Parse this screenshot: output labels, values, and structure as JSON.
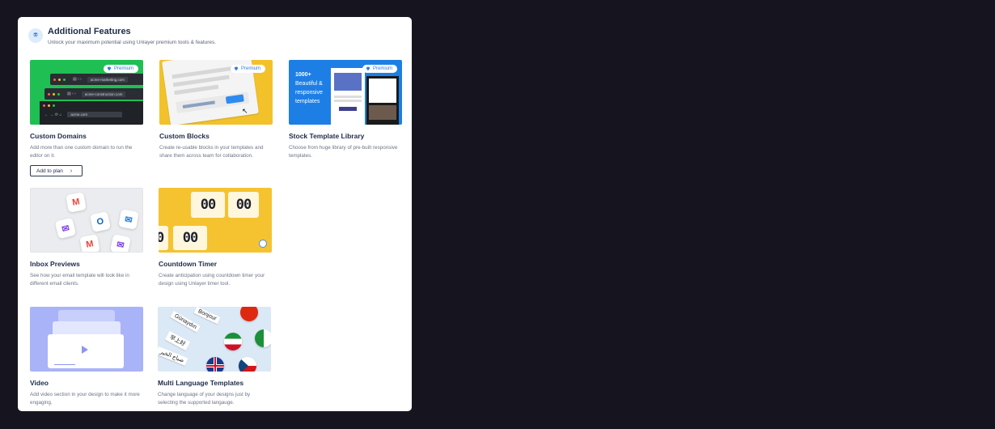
{
  "header": {
    "title": "Additional Features",
    "subtitle": "Unlock your maximum potential using Unlayer premium tools & features."
  },
  "badge_label": "Premium",
  "features": [
    {
      "title": "Custom Domains",
      "description": "Add more than one custom domain to run the editor on it.",
      "button_label": "Add to plan",
      "urls": [
        "acme-marketing.com",
        "acme-construction.com",
        "acme.com"
      ]
    },
    {
      "title": "Custom Blocks",
      "description": "Create re-usable blocks in your templates and share them across team for collaboration."
    },
    {
      "title": "Stock Template Library",
      "description": "Choose from huge library of pre-built responsive templates.",
      "thumb_heading": "1000+",
      "thumb_lines": [
        "Beautiful &",
        "responsive",
        "templates"
      ]
    },
    {
      "title": "Inbox Previews",
      "description": "See how your email template will look like in different email clients."
    },
    {
      "title": "Countdown Timer",
      "description": "Create anticipation using countdown timer your design using Unlayer timer tool.",
      "digits": "00"
    },
    {
      "title": "Video",
      "description": "Add video section in your design to make it more engaging."
    },
    {
      "title": "Multi Language Templates",
      "description": "Change language of your designs just by selecting the supported langauge.",
      "words": [
        "Bonjour",
        "Günaydın",
        "早上好",
        "صباح الخير"
      ]
    }
  ],
  "colors": {
    "background": "#16151f",
    "accent": "#2f7ae5",
    "green": "#1fbf54",
    "yellow": "#f3c22b",
    "blue": "#1d7fe6",
    "lavender": "#a9b3f8"
  }
}
